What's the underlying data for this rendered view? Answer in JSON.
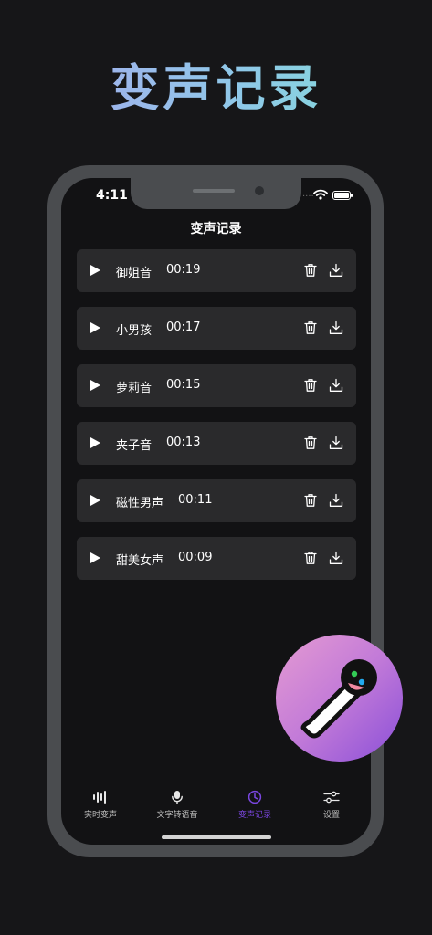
{
  "promo": {
    "headline": "变声记录"
  },
  "status_bar": {
    "time": "4:11",
    "dots": "...."
  },
  "screen": {
    "title": "变声记录"
  },
  "records": [
    {
      "name": "御姐音",
      "duration": "00:19"
    },
    {
      "name": "小男孩",
      "duration": "00:17"
    },
    {
      "name": "萝莉音",
      "duration": "00:15"
    },
    {
      "name": "夹子音",
      "duration": "00:13"
    },
    {
      "name": "磁性男声",
      "duration": "00:11"
    },
    {
      "name": "甜美女声",
      "duration": "00:09"
    }
  ],
  "tabs": [
    {
      "label": "实时变声",
      "icon": "waveform-icon",
      "active": false
    },
    {
      "label": "文字转语音",
      "icon": "microphone-icon",
      "active": false
    },
    {
      "label": "变声记录",
      "icon": "clock-icon",
      "active": true
    },
    {
      "label": "设置",
      "icon": "sliders-icon",
      "active": false
    }
  ],
  "colors": {
    "accent": "#7a46e0",
    "card": "#2a2a2c",
    "background": "#161618"
  },
  "icons": {
    "play": "play-icon",
    "delete": "trash-icon",
    "download": "download-icon",
    "logo": "microphone-icon"
  }
}
